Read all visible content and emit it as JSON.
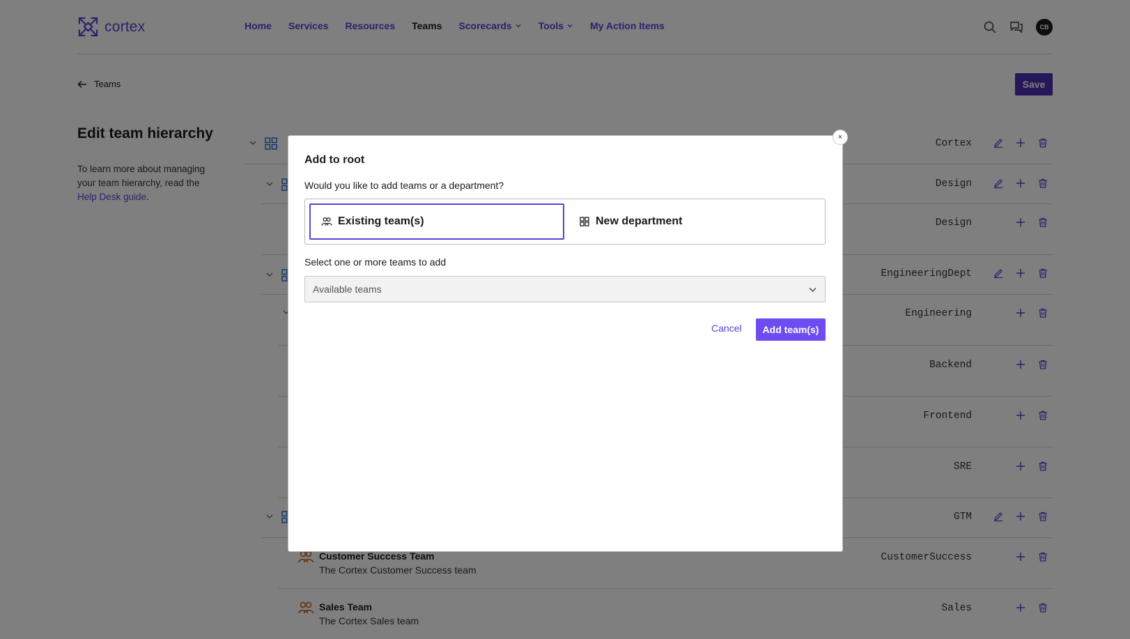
{
  "brand": {
    "name": "cortex",
    "color": "#5a3fd0"
  },
  "nav": {
    "links": [
      {
        "label": "Home"
      },
      {
        "label": "Services"
      },
      {
        "label": "Resources"
      },
      {
        "label": "Teams",
        "active": true
      },
      {
        "label": "Scorecards",
        "dropdown": true
      },
      {
        "label": "Tools",
        "dropdown": true
      },
      {
        "label": "My Action Items"
      }
    ],
    "icons": [
      "search-icon",
      "chat-icon"
    ],
    "avatar": "CB"
  },
  "subheader": {
    "back_label": "Teams",
    "save_label": "Save"
  },
  "left": {
    "title": "Edit team hierarchy",
    "help_prefix": "To learn more about managing your team hierarchy, read the ",
    "help_link": "Help Desk guide",
    "help_suffix": "."
  },
  "hierarchy": {
    "rows": [
      {
        "label": "Cortex",
        "kind": "department",
        "editable": true
      },
      {
        "label": "Design",
        "kind": "department",
        "editable": true
      },
      {
        "label": "Design",
        "kind": "team",
        "editable": false
      },
      {
        "label": "EngineeringDept",
        "kind": "department",
        "editable": true
      },
      {
        "label": "Engineering",
        "kind": "team",
        "editable": false
      },
      {
        "label": "Backend",
        "kind": "team",
        "editable": false
      },
      {
        "label": "Frontend",
        "kind": "team",
        "editable": false
      },
      {
        "label": "SRE",
        "kind": "team",
        "editable": false
      },
      {
        "label": "GTM",
        "kind": "department",
        "editable": true
      },
      {
        "label": "CustomerSuccess",
        "kind": "team",
        "editable": false,
        "name": "Customer Success Team",
        "description": "The Cortex Customer Success team"
      },
      {
        "label": "Sales",
        "kind": "team",
        "editable": false,
        "name": "Sales Team",
        "description": "The Cortex Sales team"
      }
    ]
  },
  "modal": {
    "close_glyph": "×",
    "title": "Add to root",
    "question": "Would you like to add teams or a department?",
    "options": [
      {
        "label": "Existing team(s)",
        "selected": true
      },
      {
        "label": "New department",
        "selected": false
      }
    ],
    "select_label": "Select one or more teams to add",
    "select_placeholder": "Available teams",
    "cancel_label": "Cancel",
    "submit_label": "Add team(s)"
  },
  "colors": {
    "accent": "#5b40d6",
    "button": "#6e4cf0",
    "department_icon": "#2f6fd0",
    "team_icon": "#c8611a"
  }
}
